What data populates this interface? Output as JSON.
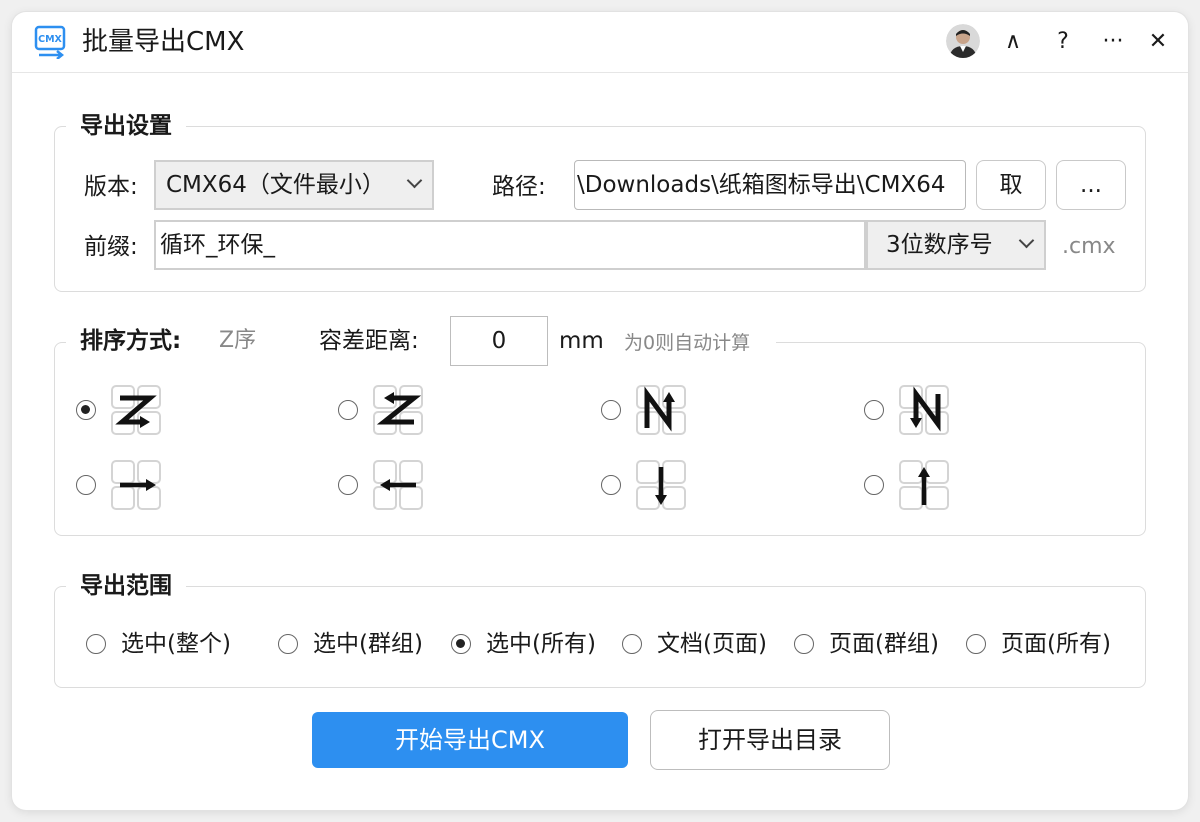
{
  "window": {
    "title": "批量导出CMX",
    "app_icon": "cmx-export-icon",
    "app_icon_text": "CMX",
    "buttons": {
      "collapse": "∧",
      "help": "?",
      "more": "···",
      "close": "✕"
    }
  },
  "export_settings": {
    "legend": "导出设置",
    "version_label": "版本:",
    "version_value": "CMX64（文件最小）",
    "path_label": "路径:",
    "path_value": "\\Downloads\\纸箱图标导出\\CMX64",
    "fetch_button": "取",
    "browse_button": "...",
    "prefix_label": "前缀:",
    "prefix_value": "循环_环保_",
    "serial_value": "3位数序号",
    "extension": ".cmx"
  },
  "sorting": {
    "legend": "排序方式:",
    "current": "Z序",
    "tolerance_label": "容差距离:",
    "tolerance_value": "0",
    "tolerance_unit": "mm",
    "tolerance_hint": "为0则自动计算",
    "options": [
      {
        "icon": "z-order-icon",
        "checked": true
      },
      {
        "icon": "reverse-z-order-icon",
        "checked": false
      },
      {
        "icon": "n-order-up-icon",
        "checked": false
      },
      {
        "icon": "n-order-down-icon",
        "checked": false
      },
      {
        "icon": "arrow-right-icon",
        "checked": false
      },
      {
        "icon": "arrow-left-icon",
        "checked": false
      },
      {
        "icon": "arrow-down-icon",
        "checked": false
      },
      {
        "icon": "arrow-up-icon",
        "checked": false
      }
    ]
  },
  "range": {
    "legend": "导出范围",
    "options": [
      {
        "label": "选中(整个)",
        "checked": false
      },
      {
        "label": "选中(群组)",
        "checked": false
      },
      {
        "label": "选中(所有)",
        "checked": true
      },
      {
        "label": "文档(页面)",
        "checked": false
      },
      {
        "label": "页面(群组)",
        "checked": false
      },
      {
        "label": "页面(所有)",
        "checked": false
      }
    ]
  },
  "actions": {
    "start": "开始导出CMX",
    "open_dir": "打开导出目录"
  },
  "colors": {
    "primary": "#2d8ff0",
    "border": "#dcdcdc",
    "hint": "#888888",
    "icon_accent": "#2d8ff0"
  }
}
